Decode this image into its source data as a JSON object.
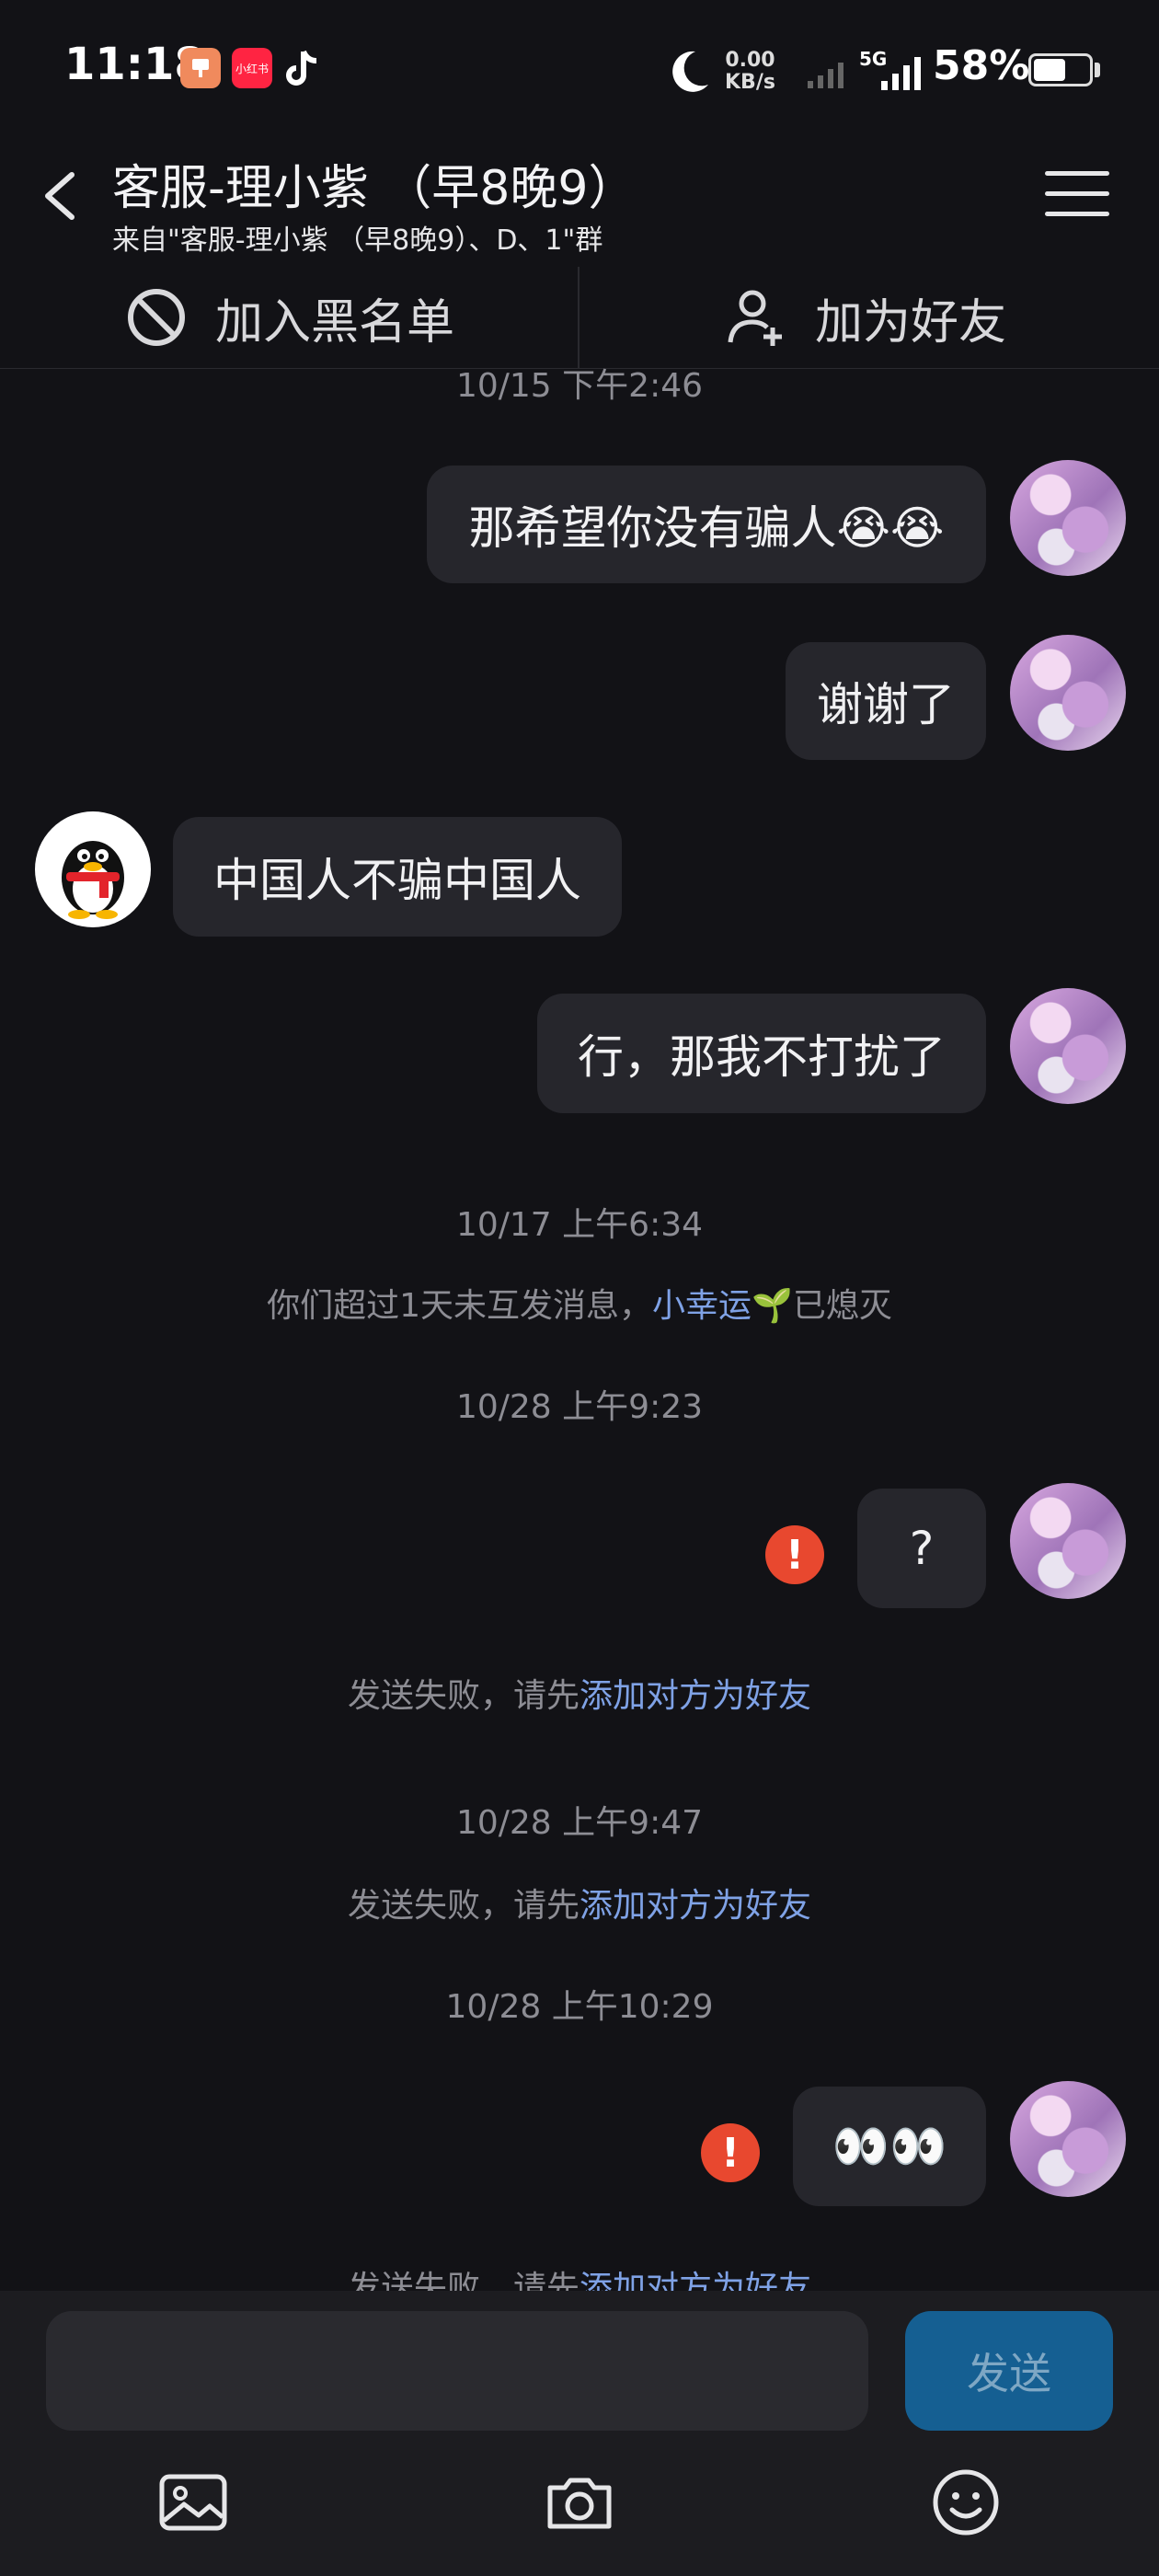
{
  "status_bar": {
    "time": "11:18",
    "net_speed_value": "0.00",
    "net_speed_unit": "KB/s",
    "network": "5G",
    "battery": "58%",
    "battery_level": 0.58,
    "app_icons": [
      "xiaohongshu-icon",
      "tiktok-icon"
    ],
    "xhs_label": "小红书"
  },
  "header": {
    "title": "客服-理小紫 （早8晚9）",
    "subtitle": "来自\"客服-理小紫 （早8晚9）、D、1\"群"
  },
  "actions": {
    "block_label": "加入黑名单",
    "add_friend_label": "加为好友"
  },
  "messages": {
    "ts_top": "10/15 下午2:46",
    "m1": "那希望你没有骗人😭😭",
    "m2": "谢谢了",
    "m3": "中国人不骗中国人",
    "m4": "行，那我不打扰了",
    "ts2": "10/17 上午6:34",
    "notice2_prefix": "你们超过1天未互发消息，",
    "notice2_link": "小幸运",
    "notice2_suffix": "🌱已熄灭",
    "ts3": "10/28 上午9:23",
    "m5": "?",
    "fail_prefix": "发送失败，请先",
    "fail_link": "添加对方为好友",
    "ts4": "10/28 上午9:47",
    "ts5": "10/28 上午10:29",
    "m6": "👀👀"
  },
  "input_bar": {
    "send_label": "发送"
  },
  "colors": {
    "background": "#121216",
    "bubble": "#26262c",
    "link": "#7fa2e6",
    "error": "#e8482f",
    "send_button": "#155f92"
  }
}
